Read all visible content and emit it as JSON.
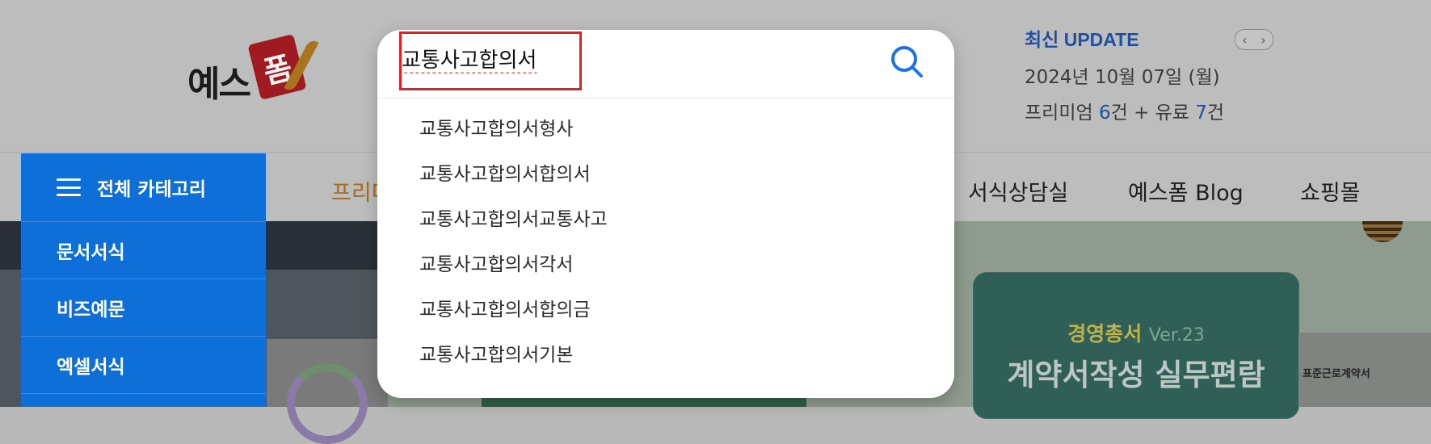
{
  "header": {
    "logo_text": "예스",
    "logo_stamp": "폼"
  },
  "update": {
    "title": "최신 UPDATE",
    "date": "2024년 10월 07일 (월)",
    "counts_prefix": "프리미엄 ",
    "premium_count": "6",
    "counts_mid": "건 + 유료 ",
    "paid_count": "7",
    "counts_suffix": "건",
    "prev_icon": "chevron-left-icon",
    "next_icon": "chevron-right-icon"
  },
  "nav": {
    "premium_partial": "프리미",
    "items": [
      "서식상담실",
      "예스폼 Blog",
      "쇼핑몰"
    ]
  },
  "categories": {
    "header": "전체 카테고리",
    "items": [
      "문서서식",
      "비즈예문",
      "엑셀서식"
    ]
  },
  "search": {
    "value": "교통사고합의서",
    "suggestions": [
      "교통사고합의서형사",
      "교통사고합의서합의서",
      "교통사고합의서교통사고",
      "교통사고합의서각서",
      "교통사고합의서합의금",
      "교통사고합의서기본"
    ]
  },
  "banner": {
    "book_subtitle": "경영총서",
    "book_version": "Ver.23",
    "book_title": "계약서작성 실무편람",
    "doc_title": "표준근로계약서"
  },
  "colors": {
    "accent_blue": "#0f6fd8",
    "highlight_red": "#e22020",
    "update_blue": "#1f4fa0"
  }
}
